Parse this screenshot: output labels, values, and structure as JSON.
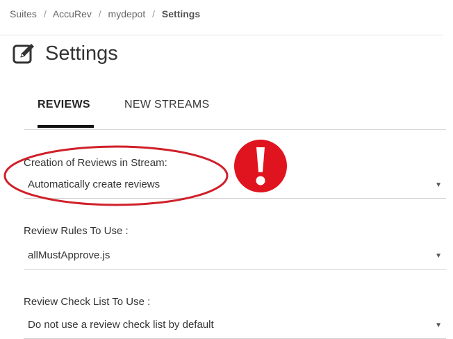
{
  "breadcrumb": {
    "items": [
      "Suites",
      "AccuRev",
      "mydepot"
    ],
    "separator": "/",
    "current": "Settings"
  },
  "header": {
    "icon": "edit-icon",
    "title": "Settings"
  },
  "tabs": [
    {
      "label": "REVIEWS",
      "active": true
    },
    {
      "label": "NEW STREAMS",
      "active": false
    }
  ],
  "fields": {
    "creation": {
      "label": "Creation of Reviews in Stream:",
      "value": "Automatically create reviews"
    },
    "rules": {
      "label": "Review Rules To Use :",
      "value": "allMustApprove.js"
    },
    "checklist": {
      "label": "Review Check List To Use :",
      "value": "Do not use a review check list by default"
    }
  },
  "annotation": {
    "ellipse_color": "#d0202a",
    "badge_color": "#e0141e",
    "badge_icon": "exclamation-icon"
  },
  "colors": {
    "tab_active_underline": "#111111",
    "divider": "#d9d9d9"
  }
}
